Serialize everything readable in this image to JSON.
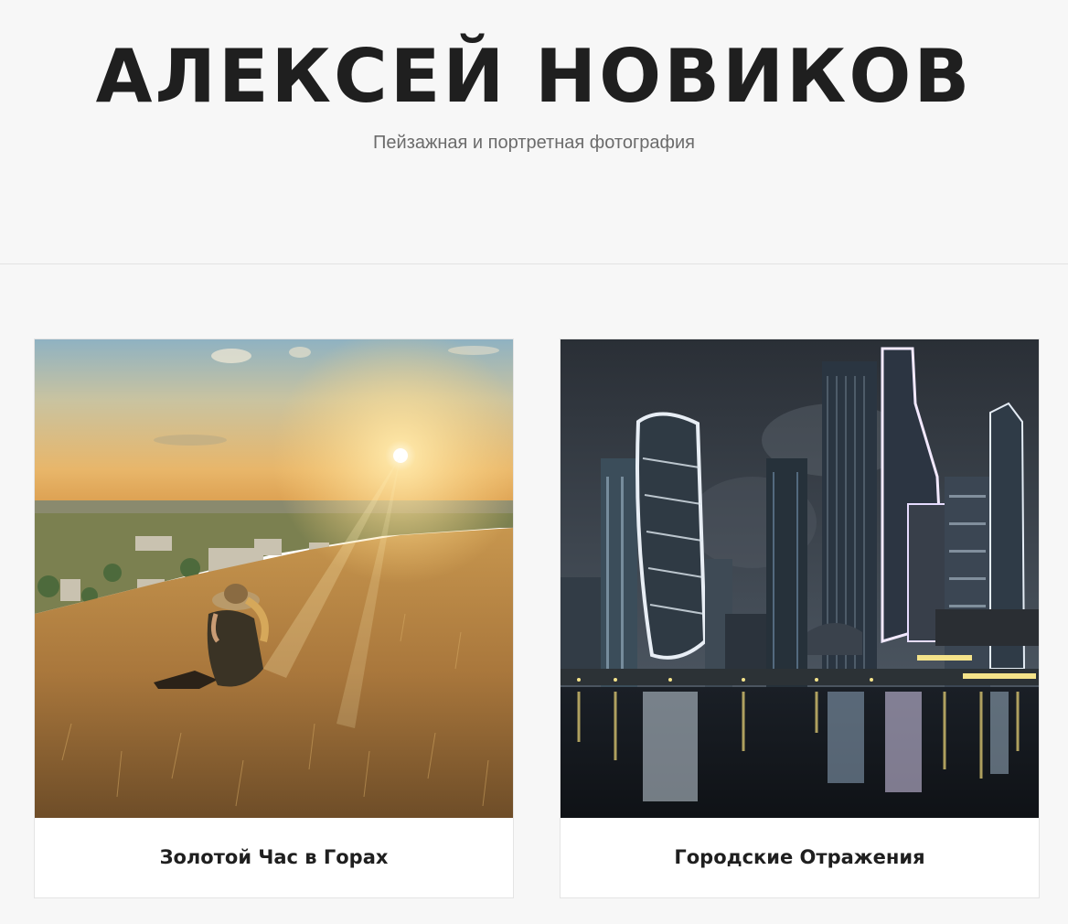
{
  "header": {
    "title": "АЛЕКСЕЙ НОВИКОВ",
    "subtitle": "Пейзажная и портретная фотография"
  },
  "gallery": {
    "items": [
      {
        "title": "Золотой Час в Горах",
        "image": "golden-hour-hillside-photo"
      },
      {
        "title": "Городские Отражения",
        "image": "night-city-skyline-reflection-photo"
      }
    ]
  },
  "colors": {
    "page_background": "#f7f7f7",
    "title_text": "#1f1f1f",
    "subtitle_text": "#6b6b6b",
    "card_background": "#ffffff",
    "divider": "#e2e2e2"
  }
}
